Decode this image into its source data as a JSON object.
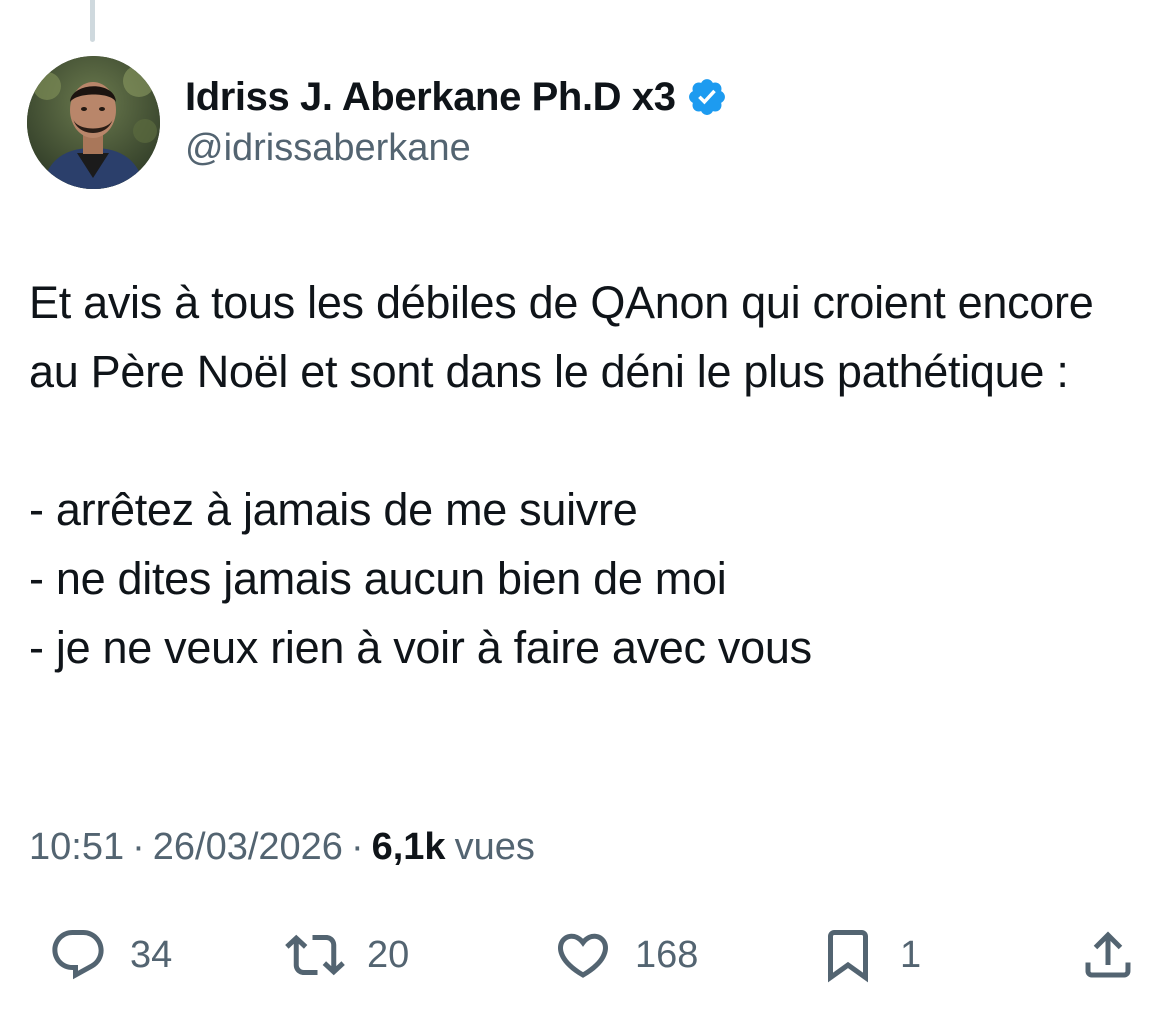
{
  "author": {
    "name": "Idriss J. Aberkane Ph.D x3",
    "handle": "@idrissaberkane",
    "verified_color": "#1d9bf0",
    "avatar_icon": "profile-photo"
  },
  "tweet": {
    "text": "Et avis à tous les débiles de QAnon qui croient encore au Père Noël et sont dans le déni le plus pathétique :\n\n- arrêtez à jamais de me suivre\n- ne dites jamais aucun bien de moi\n- je ne veux rien à voir à faire avec vous"
  },
  "meta": {
    "time": "10:51",
    "separator": "·",
    "date": "26/03/2026",
    "views_count": "6,1k",
    "views_label": "vues"
  },
  "actions": {
    "reply": {
      "icon": "reply-icon",
      "count": "34"
    },
    "retweet": {
      "icon": "retweet-icon",
      "count": "20"
    },
    "like": {
      "icon": "heart-icon",
      "count": "168"
    },
    "bookmark": {
      "icon": "bookmark-icon",
      "count": "1"
    },
    "share": {
      "icon": "share-icon"
    }
  },
  "colors": {
    "text": "#0f1419",
    "secondary": "#536471",
    "thread_line": "#cfd9de"
  }
}
